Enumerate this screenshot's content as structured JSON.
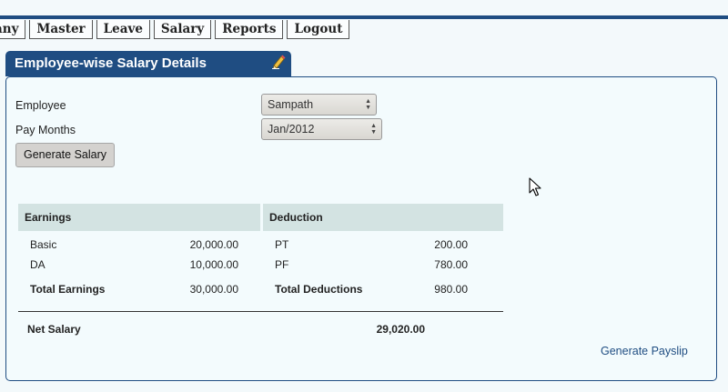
{
  "menu": {
    "items": [
      {
        "label": "any"
      },
      {
        "label": "Master"
      },
      {
        "label": "Leave"
      },
      {
        "label": "Salary"
      },
      {
        "label": "Reports"
      },
      {
        "label": "Logout"
      }
    ]
  },
  "panel": {
    "title": "Employee-wise Salary Details"
  },
  "form": {
    "employee_label": "Employee",
    "employee_value": "Sampath",
    "pay_months_label": "Pay Months",
    "pay_months_value": "Jan/2012",
    "generate_button": "Generate Salary"
  },
  "salary_table": {
    "earnings_header": "Earnings",
    "deduction_header": "Deduction",
    "earnings": [
      {
        "name": "Basic",
        "amount": "20,000.00"
      },
      {
        "name": "DA",
        "amount": "10,000.00"
      }
    ],
    "deductions": [
      {
        "name": "PT",
        "amount": "200.00"
      },
      {
        "name": "PF",
        "amount": "780.00"
      }
    ],
    "total_earnings_label": "Total Earnings",
    "total_earnings_value": "30,000.00",
    "total_deductions_label": "Total Deductions",
    "total_deductions_value": "980.00",
    "net_salary_label": "Net Salary",
    "net_salary_value": "29,020.00"
  },
  "actions": {
    "generate_payslip": "Generate Payslip"
  }
}
